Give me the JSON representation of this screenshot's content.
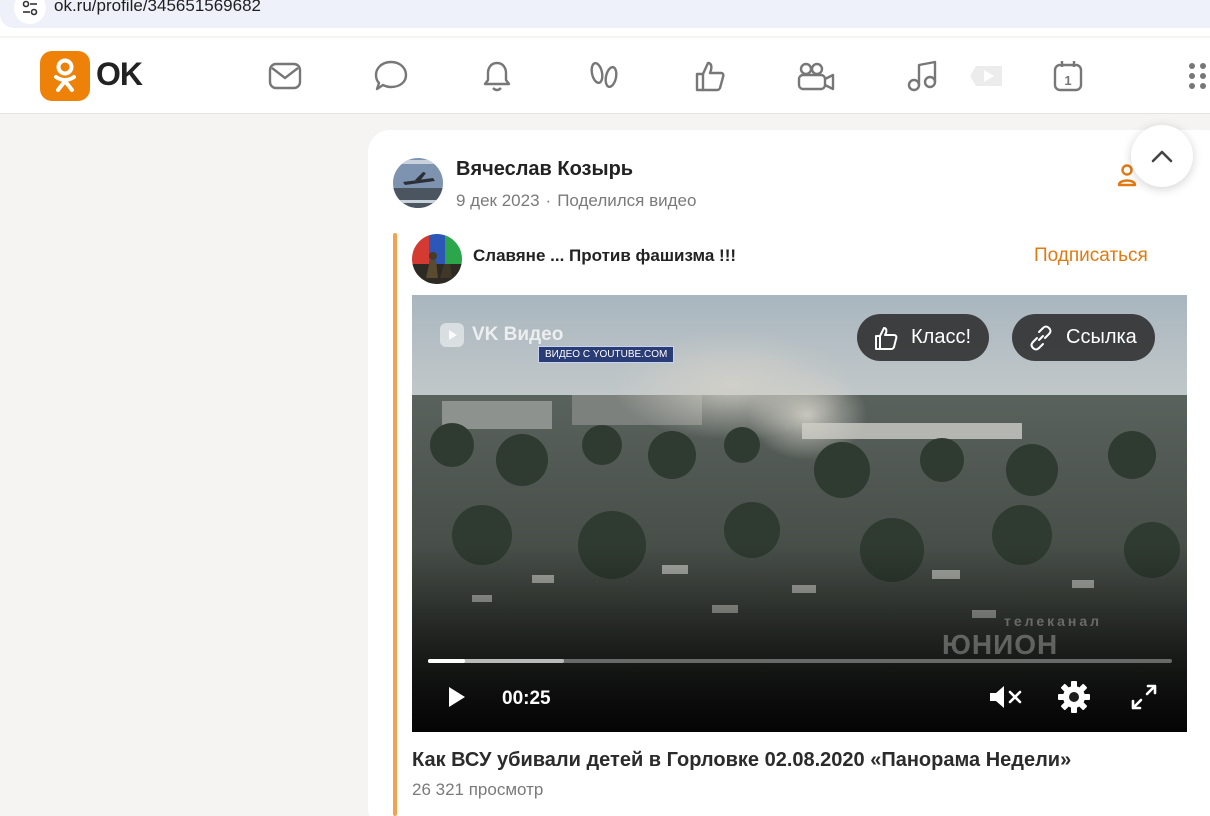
{
  "browser": {
    "url": "ok.ru/profile/345651569682"
  },
  "header": {
    "logo_text": "OK",
    "brand_color": "#ee8208",
    "nav_icons": [
      "messages-icon",
      "discussions-icon",
      "notifications-icon",
      "guests-icon",
      "events-icon",
      "video-icon",
      "music-icon",
      "vk-video-icon",
      "calendar-icon",
      "apps-grid-icon"
    ],
    "calendar_day": "1"
  },
  "post": {
    "author": "Вячеслав Козырь",
    "date": "9 дек 2023",
    "separator": "·",
    "action": "Поделился видео",
    "group": {
      "name": "Славяне ... Против фашизма !!!",
      "subscribe_label": "Подписаться"
    },
    "video": {
      "provider_label": "VK Видео",
      "source_tag": "ВИДЕО С YOUTUBE.COM",
      "like_label": "Класс!",
      "link_label": "Ссылка",
      "time": "00:25",
      "played_fraction": 0.05,
      "buffered_fraction": 0.183,
      "muted": true,
      "watermark_top": "телеканал",
      "watermark_main": "ЮНИОН",
      "title": "Как ВСУ убивали детей в Горловке 02.08.2020 «Панорама Недели»",
      "views": "26 321 просмотр"
    }
  },
  "accent_color": "#e07a10"
}
